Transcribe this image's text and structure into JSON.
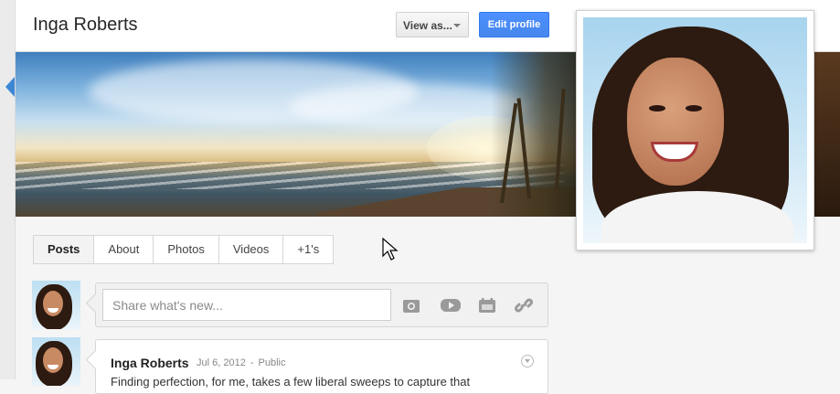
{
  "profile": {
    "name": "Inga Roberts"
  },
  "header": {
    "view_as_label": "View as...",
    "edit_profile_label": "Edit profile"
  },
  "tabs": [
    {
      "label": "Posts",
      "active": true
    },
    {
      "label": "About",
      "active": false
    },
    {
      "label": "Photos",
      "active": false
    },
    {
      "label": "Videos",
      "active": false
    },
    {
      "label": "+1's",
      "active": false
    }
  ],
  "share": {
    "placeholder": "Share what's new...",
    "icons": [
      "camera-icon",
      "video-icon",
      "calendar-icon",
      "link-icon"
    ]
  },
  "post": {
    "author": "Inga Roberts",
    "date": "Jul 6, 2012",
    "separator": "-",
    "visibility": "Public",
    "text": "Finding perfection, for me, takes a few liberal sweeps to capture that"
  },
  "colors": {
    "accent": "#4d90fe",
    "header_bg": "#ffffff",
    "page_bg": "#f5f5f5"
  }
}
